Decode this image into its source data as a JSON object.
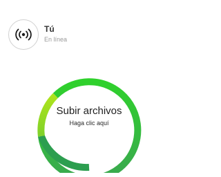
{
  "user": {
    "name": "Tú",
    "status": "En línea",
    "avatar_icon": "broadcast-icon"
  },
  "upload": {
    "title": "Subir archivos",
    "subtitle": "Haga clic aquí",
    "colors": {
      "ring_top": "#33cc33",
      "ring_left": "#99dd22",
      "ring_bottom": "#2fa550",
      "ring_right": "#3dbb44"
    }
  }
}
